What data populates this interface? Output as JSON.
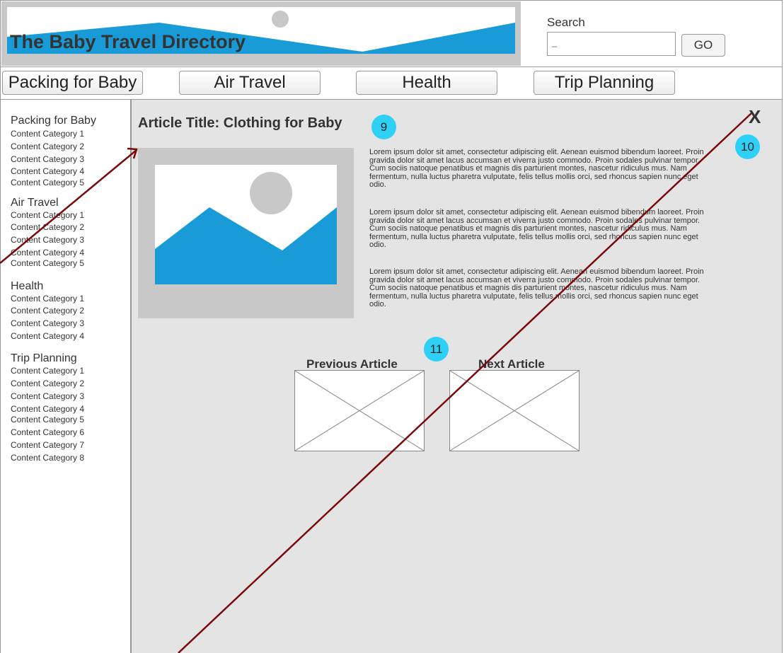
{
  "header": {
    "site_title": "The Baby Travel Directory",
    "search_label": "Search",
    "search_value": "_",
    "go_label": "GO"
  },
  "nav": {
    "items": [
      "Packing for Baby",
      "Air Travel",
      "Health",
      "Trip Planning"
    ]
  },
  "sidebar": {
    "sections": [
      {
        "title": "Packing for Baby",
        "items": [
          "Content Category 1",
          "Content Category 2",
          "Content Category 3",
          "Content Category 4",
          "Content Category 5"
        ]
      },
      {
        "title": "Air Travel",
        "items": [
          "Content Category 1",
          "Content Category 2",
          "Content Category 3",
          "Content Category 4",
          "Content Category 5"
        ]
      },
      {
        "title": "Health",
        "items": [
          "Content Category 1",
          "Content Category 2",
          "Content Category 3",
          "Content Category 4"
        ]
      },
      {
        "title": "Trip Planning",
        "items": [
          "Content Category 1",
          "Content Category 2",
          "Content Category 3",
          "Content Category 4",
          "Content Category 5",
          "Content Category 6",
          "Content Category 7",
          "Content Category 8"
        ]
      }
    ]
  },
  "article": {
    "title": "Article Title: Clothing for Baby",
    "paragraphs": [
      "Lorem ipsum dolor sit amet, consectetur adipiscing elit. Aenean euismod bibendum laoreet. Proin gravida dolor sit amet lacus accumsan et viverra justo commodo. Proin sodales pulvinar tempor. Cum sociis natoque penatibus et magnis dis parturient montes, nascetur ridiculus mus. Nam fermentum, nulla luctus pharetra vulputate, felis tellus mollis orci, sed rhoncus sapien nunc eget odio.",
      "Lorem ipsum dolor sit amet, consectetur adipiscing elit. Aenean euismod bibendum laoreet. Proin gravida dolor sit amet lacus accumsan et viverra justo commodo. Proin sodales pulvinar tempor. Cum sociis natoque penatibus et magnis dis parturient montes, nascetur ridiculus mus. Nam fermentum, nulla luctus pharetra vulputate, felis tellus mollis orci, sed rhoncus sapien nunc eget odio.",
      "Lorem ipsum dolor sit amet, consectetur adipiscing elit. Aenean euismod bibendum laoreet. Proin gravida dolor sit amet lacus accumsan et viverra justo commodo. Proin sodales pulvinar tempor. Cum sociis natoque penatibus et magnis dis parturient montes, nascetur ridiculus mus. Nam fermentum, nulla luctus pharetra vulputate, felis tellus mollis orci, sed rhoncus sapien nunc eget odio."
    ],
    "close_label": "X",
    "previous_label": "Previous Article",
    "next_label": "Next Article"
  },
  "annotations": {
    "badge_title": "9",
    "badge_close": "10",
    "badge_nav": "11"
  },
  "colors": {
    "accent_blue": "#189bd6",
    "badge_cyan": "#2ed0f6",
    "arrow_red": "#7a0a0a",
    "placeholder_gray": "#c8c8c8"
  }
}
